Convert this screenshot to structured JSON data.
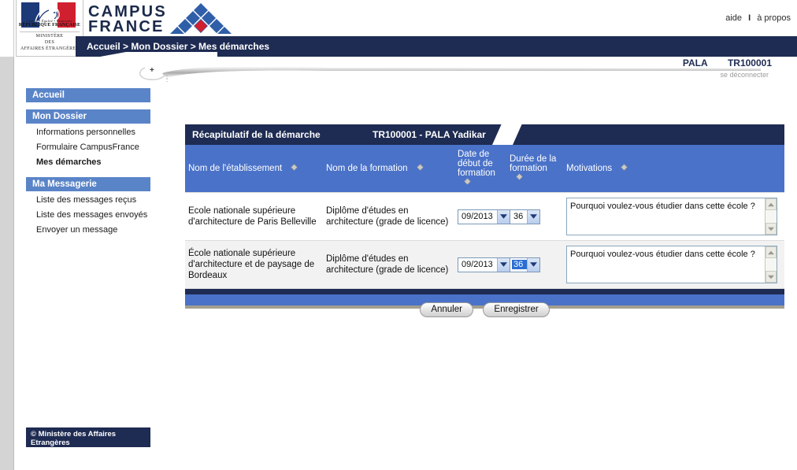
{
  "brand": {
    "republic_devise": "Liberté • Égalité • Fraternité",
    "republic_name": "RÉPUBLIQUE FRANÇAISE",
    "ministry_line1": "MINISTÈRE",
    "ministry_line2": "DES",
    "ministry_line3": "AFFAIRES ÉTRANGÈRES",
    "campus_line1": "CAMPUS",
    "campus_line2": "FRANCE",
    "logo_blue": "#1d3a78",
    "logo_red": "#d0202f",
    "pyramid_blue": "#2f5fa8",
    "pyramid_red": "#d0202f"
  },
  "toplinks": {
    "help": "aide",
    "separator": "I",
    "about": "à propos"
  },
  "breadcrumb": {
    "text": "Accueil > Mon Dossier > Mes démarches"
  },
  "user": {
    "name": "PALA",
    "reference": "TR100001",
    "logout": "se déconnecter"
  },
  "expander": {
    "icon": "+"
  },
  "sidebar": {
    "groups": [
      {
        "header": "Accueil",
        "items": []
      },
      {
        "header": "Mon Dossier",
        "items": [
          {
            "label": "Informations personnelles",
            "current": false
          },
          {
            "label": "Formulaire CampusFrance",
            "current": false
          },
          {
            "label": "Mes démarches",
            "current": true
          }
        ]
      },
      {
        "header": "Ma Messagerie",
        "items": [
          {
            "label": "Liste des messages reçus",
            "current": false
          },
          {
            "label": "Liste des messages envoyés",
            "current": false
          },
          {
            "label": "Envoyer un message",
            "current": false
          }
        ]
      }
    ],
    "footer": "© Ministère des Affaires Etrangères"
  },
  "panel": {
    "title": "Récapitulatif de la démarche",
    "reference": "TR100001 - PALA Yadikar",
    "header_bg": "#1e2b52",
    "table_header_bg": "#4a72c8"
  },
  "table": {
    "columns": [
      {
        "label": "Nom de l'établissement",
        "sort_icon": "sort-icon"
      },
      {
        "label": "Nom de la formation",
        "sort_icon": "sort-icon"
      },
      {
        "label": "Date de début de formation",
        "sort_icon": "sort-icon"
      },
      {
        "label": "Durée de la formation",
        "sort_icon": "sort-icon"
      },
      {
        "label": "Motivations",
        "sort_icon": "sort-icon"
      }
    ],
    "rows": [
      {
        "establishment": "Ecole nationale supérieure d'architecture de Paris Belleville",
        "formation": "Diplôme d'études en architecture (grade de licence)",
        "start_date": "09/2013",
        "duration": "36",
        "duration_focused": false,
        "motivation": "Pourquoi voulez-vous étudier dans cette école ?"
      },
      {
        "establishment": "École nationale supérieure d'architecture et de paysage de Bordeaux",
        "formation": "Diplôme d'études en architecture (grade de licence)",
        "start_date": "09/2013",
        "duration": "36",
        "duration_focused": true,
        "motivation": "Pourquoi voulez-vous étudier dans cette école ?"
      }
    ]
  },
  "actions": {
    "cancel": "Annuler",
    "save": "Enregistrer"
  }
}
